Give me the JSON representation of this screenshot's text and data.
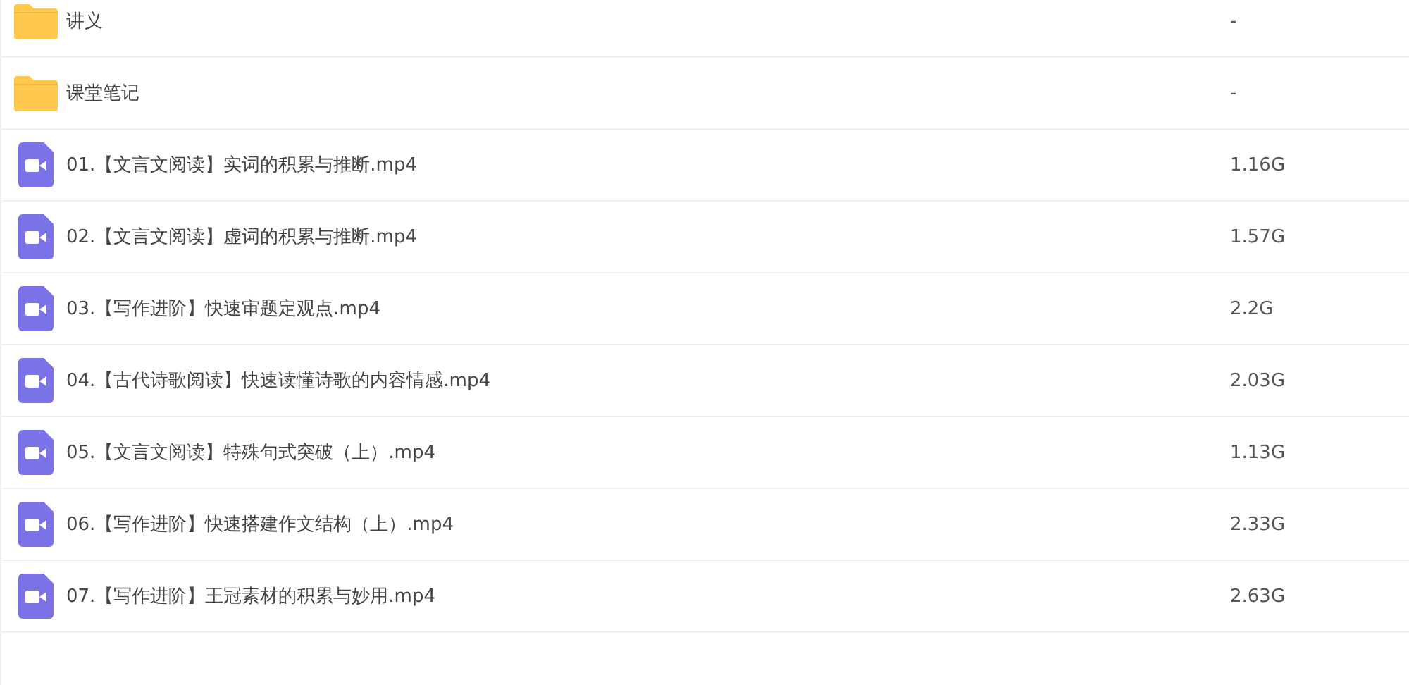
{
  "files": [
    {
      "kind": "folder",
      "name": "讲义",
      "size": "-"
    },
    {
      "kind": "folder",
      "name": "课堂笔记",
      "size": "-"
    },
    {
      "kind": "video",
      "name": "01.【文言文阅读】实词的积累与推断.mp4",
      "size": "1.16G"
    },
    {
      "kind": "video",
      "name": "02.【文言文阅读】虚词的积累与推断.mp4",
      "size": "1.57G"
    },
    {
      "kind": "video",
      "name": "03.【写作进阶】快速审题定观点.mp4",
      "size": "2.2G"
    },
    {
      "kind": "video",
      "name": "04.【古代诗歌阅读】快速读懂诗歌的内容情感.mp4",
      "size": "2.03G"
    },
    {
      "kind": "video",
      "name": "05.【文言文阅读】特殊句式突破（上）.mp4",
      "size": "1.13G"
    },
    {
      "kind": "video",
      "name": "06.【写作进阶】快速搭建作文结构（上）.mp4",
      "size": "2.33G"
    },
    {
      "kind": "video",
      "name": "07.【写作进阶】王冠素材的积累与妙用.mp4",
      "size": "2.63G"
    }
  ]
}
